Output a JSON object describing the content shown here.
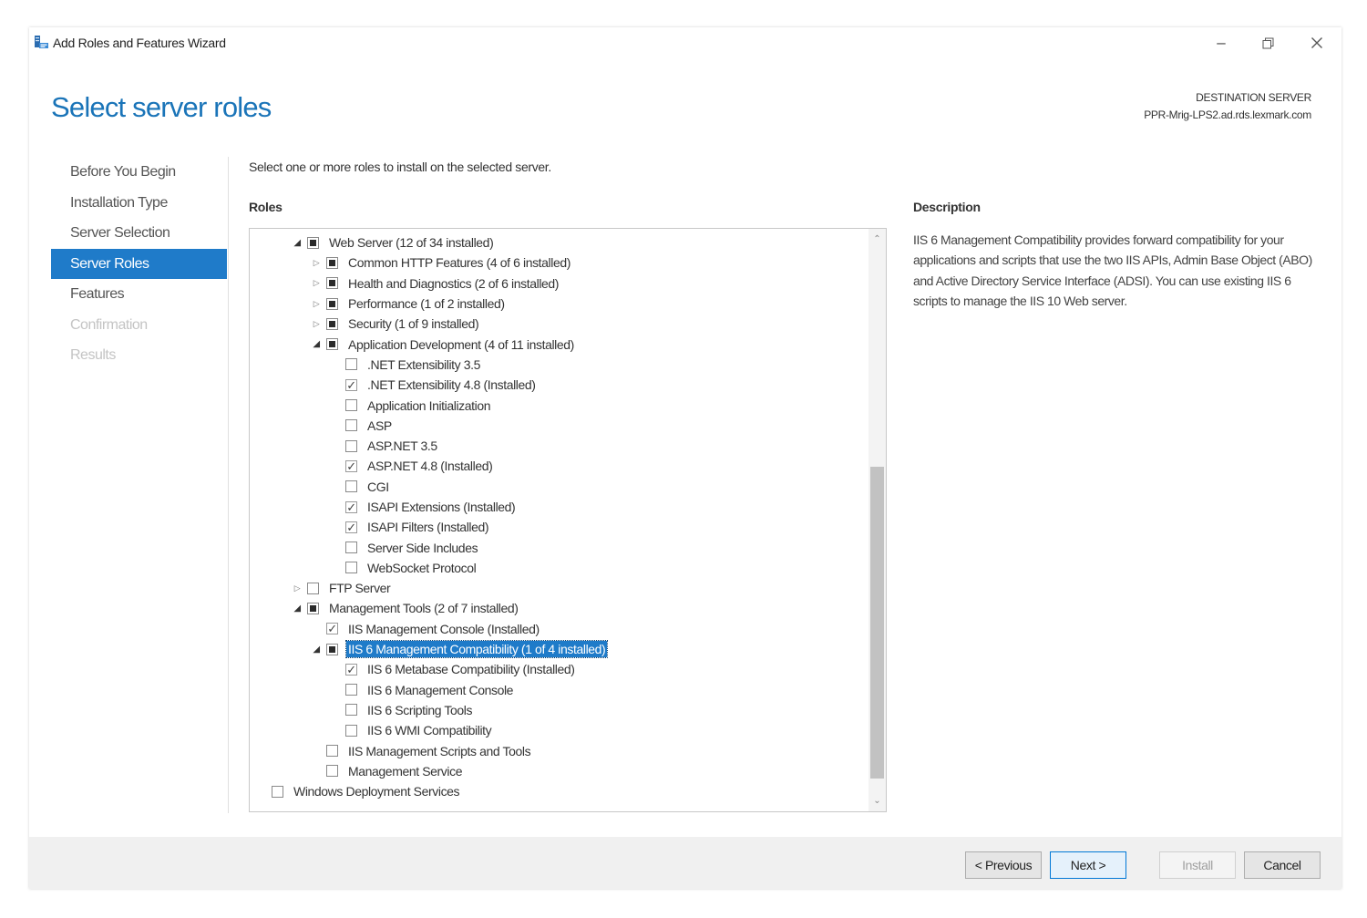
{
  "window": {
    "title": "Add Roles and Features Wizard",
    "icons": {
      "app": "server-manager-icon",
      "minimize": "minimize-icon",
      "restore": "restore-icon",
      "close": "close-icon"
    }
  },
  "header": {
    "title": "Select server roles",
    "destination_label": "DESTINATION SERVER",
    "destination_value": "PPR-Mrig-LPS2.ad.rds.lexmark.com"
  },
  "nav": {
    "items": [
      {
        "label": "Before You Begin",
        "state": "normal"
      },
      {
        "label": "Installation Type",
        "state": "normal"
      },
      {
        "label": "Server Selection",
        "state": "normal"
      },
      {
        "label": "Server Roles",
        "state": "active"
      },
      {
        "label": "Features",
        "state": "normal"
      },
      {
        "label": "Confirmation",
        "state": "disabled"
      },
      {
        "label": "Results",
        "state": "disabled"
      }
    ]
  },
  "main": {
    "instruction": "Select one or more roles to install on the selected server.",
    "roles_label": "Roles",
    "description_label": "Description",
    "description_text": "IIS 6 Management Compatibility provides forward compatibility for your applications and scripts that use the two IIS APIs, Admin Base Object (ABO) and Active Directory Service Interface (ADSI). You can use existing IIS 6 scripts to manage the IIS 10 Web server."
  },
  "roles": [
    {
      "label": "Web Server (12 of 34 installed)",
      "level": 1,
      "expander": "open",
      "state": "indeterminate"
    },
    {
      "label": "Common HTTP Features (4 of 6 installed)",
      "level": 2,
      "expander": "closed",
      "state": "indeterminate"
    },
    {
      "label": "Health and Diagnostics (2 of 6 installed)",
      "level": 2,
      "expander": "closed",
      "state": "indeterminate"
    },
    {
      "label": "Performance (1 of 2 installed)",
      "level": 2,
      "expander": "closed",
      "state": "indeterminate"
    },
    {
      "label": "Security (1 of 9 installed)",
      "level": 2,
      "expander": "closed",
      "state": "indeterminate"
    },
    {
      "label": "Application Development (4 of 11 installed)",
      "level": 2,
      "expander": "open",
      "state": "indeterminate"
    },
    {
      "label": ".NET Extensibility 3.5",
      "level": 3,
      "expander": "none",
      "state": "unchecked"
    },
    {
      "label": ".NET Extensibility 4.8 (Installed)",
      "level": 3,
      "expander": "none",
      "state": "checked"
    },
    {
      "label": "Application Initialization",
      "level": 3,
      "expander": "none",
      "state": "unchecked"
    },
    {
      "label": "ASP",
      "level": 3,
      "expander": "none",
      "state": "unchecked"
    },
    {
      "label": "ASP.NET 3.5",
      "level": 3,
      "expander": "none",
      "state": "unchecked"
    },
    {
      "label": "ASP.NET 4.8 (Installed)",
      "level": 3,
      "expander": "none",
      "state": "checked"
    },
    {
      "label": "CGI",
      "level": 3,
      "expander": "none",
      "state": "unchecked"
    },
    {
      "label": "ISAPI Extensions (Installed)",
      "level": 3,
      "expander": "none",
      "state": "checked"
    },
    {
      "label": "ISAPI Filters (Installed)",
      "level": 3,
      "expander": "none",
      "state": "checked"
    },
    {
      "label": "Server Side Includes",
      "level": 3,
      "expander": "none",
      "state": "unchecked"
    },
    {
      "label": "WebSocket Protocol",
      "level": 3,
      "expander": "none",
      "state": "unchecked"
    },
    {
      "label": "FTP Server",
      "level": 1,
      "expander": "closed",
      "state": "unchecked"
    },
    {
      "label": "Management Tools (2 of 7 installed)",
      "level": 1,
      "expander": "open",
      "state": "indeterminate"
    },
    {
      "label": "IIS Management Console (Installed)",
      "level": 2,
      "expander": "none",
      "state": "checked"
    },
    {
      "label": "IIS 6 Management Compatibility (1 of 4 installed)",
      "level": 2,
      "expander": "open",
      "state": "indeterminate",
      "selected": true
    },
    {
      "label": "IIS 6 Metabase Compatibility (Installed)",
      "level": 3,
      "expander": "none",
      "state": "checked"
    },
    {
      "label": "IIS 6 Management Console",
      "level": 3,
      "expander": "none",
      "state": "unchecked"
    },
    {
      "label": "IIS 6 Scripting Tools",
      "level": 3,
      "expander": "none",
      "state": "unchecked"
    },
    {
      "label": "IIS 6 WMI Compatibility",
      "level": 3,
      "expander": "none",
      "state": "unchecked"
    },
    {
      "label": "IIS Management Scripts and Tools",
      "level": 2,
      "expander": "none",
      "state": "unchecked"
    },
    {
      "label": "Management Service",
      "level": 2,
      "expander": "none",
      "state": "unchecked"
    },
    {
      "label": "Windows Deployment Services",
      "level": 0,
      "expander": "none",
      "state": "unchecked"
    }
  ],
  "footer": {
    "previous_label": "< Previous",
    "next_label": "Next >",
    "install_label": "Install",
    "cancel_label": "Cancel"
  },
  "colors": {
    "accent": "#1f7bc9",
    "title": "#1a74b8"
  }
}
